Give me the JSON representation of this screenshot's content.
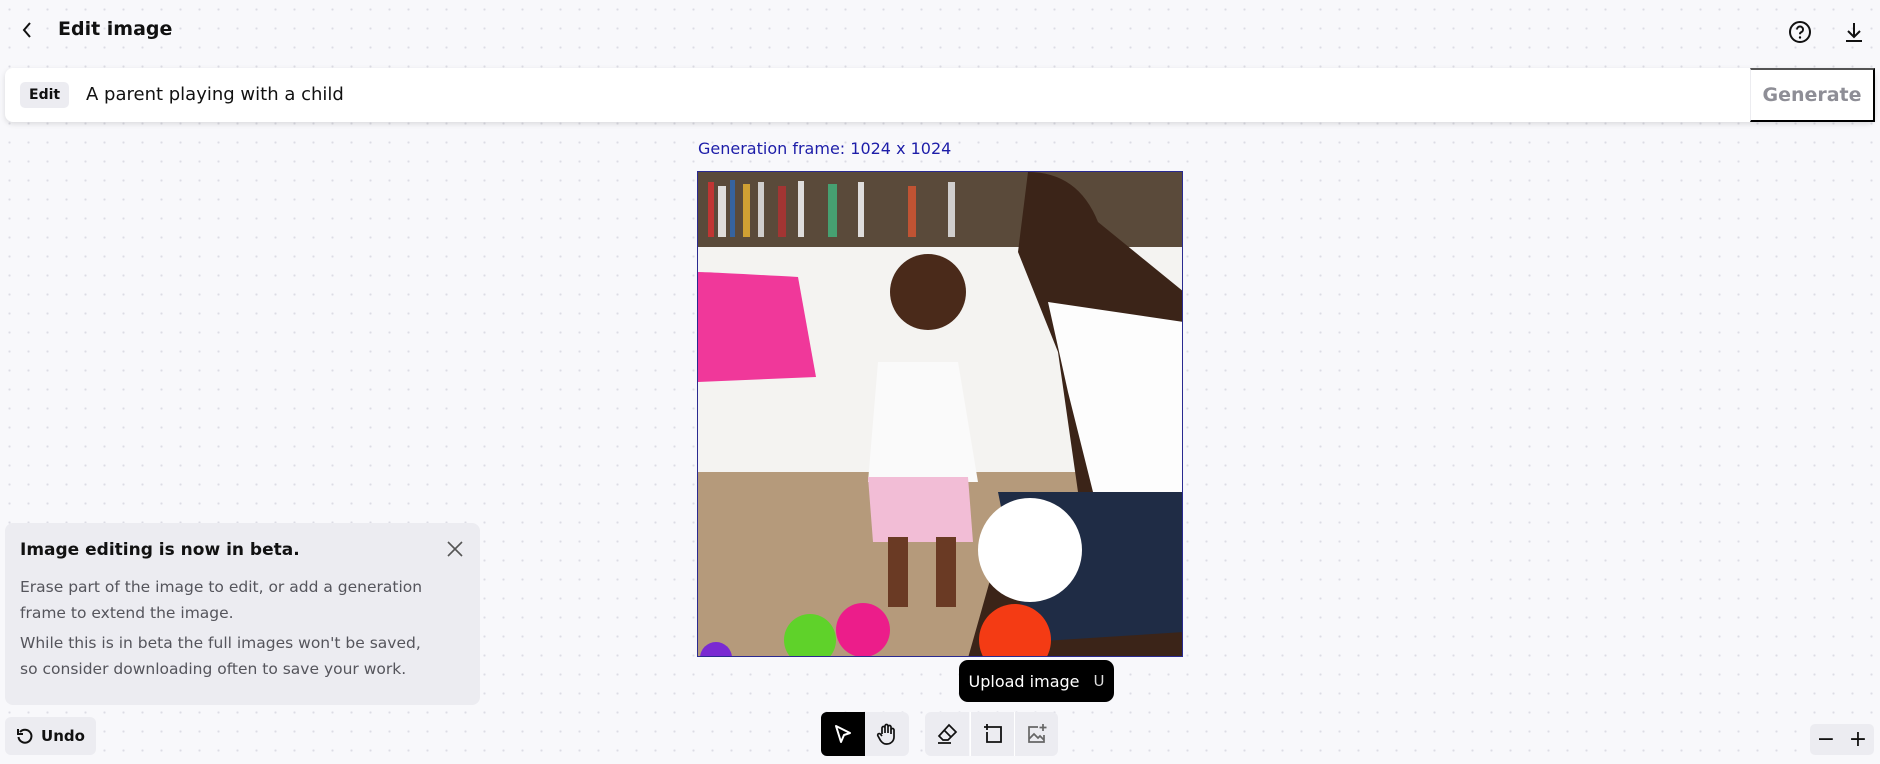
{
  "header": {
    "title": "Edit image",
    "back_icon": "chevron-left-icon",
    "help_icon": "question-circle-icon",
    "download_icon": "download-icon"
  },
  "prompt_bar": {
    "mode_label": "Edit",
    "prompt_value": "A parent playing with a child",
    "generate_label": "Generate"
  },
  "canvas": {
    "frame_label": "Generation frame: 1024 x 1024"
  },
  "beta_notice": {
    "title": "Image editing is now in beta.",
    "paragraphs": [
      "Erase part of the image to edit, or add a generation frame to extend the image.",
      "While this is in beta the full images won't be saved, so consider downloading often to save your work."
    ]
  },
  "undo_label": "Undo",
  "toolbar": {
    "tools": [
      "select",
      "pan",
      "eraser",
      "add-frame",
      "upload-image"
    ],
    "active": "select"
  },
  "tooltip": {
    "label": "Upload image",
    "shortcut": "U"
  },
  "zoom": {
    "out": "−",
    "in": "+"
  }
}
